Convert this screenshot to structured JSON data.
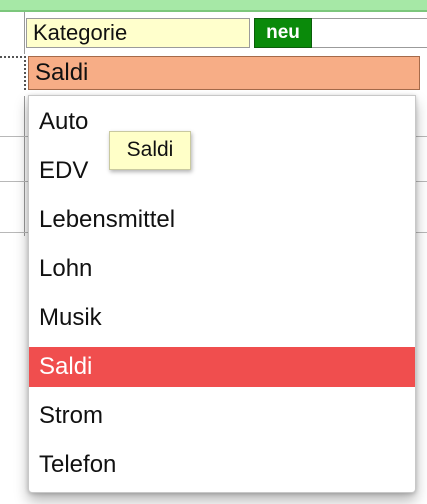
{
  "form": {
    "kategorie_label": "Kategorie",
    "neu_button": "neu",
    "selected_value": "Saldi"
  },
  "dropdown": {
    "options": [
      "Auto",
      "EDV",
      "Lebensmittel",
      "Lohn",
      "Musik",
      "Saldi",
      "Strom",
      "Telefon"
    ],
    "highlighted": "Saldi"
  },
  "tooltip": {
    "text": "Saldi"
  },
  "colors": {
    "kategorie_bg": "#ffffcc",
    "neu_bg": "#0a8a0a",
    "field_bg": "#f7ad86",
    "highlight_bg": "#f04e4e",
    "tooltip_bg": "#ffffc8",
    "top_strip": "#a6e8a6"
  }
}
